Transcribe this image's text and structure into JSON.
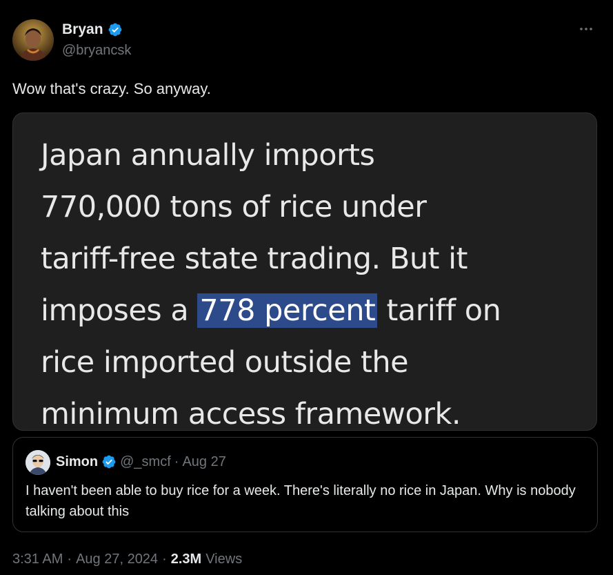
{
  "author": {
    "name": "Bryan",
    "handle": "@bryancsk",
    "verified_color": "#1d9bf0"
  },
  "menu_icon": "more-horizontal-icon",
  "tweet": {
    "text": "Wow that's crazy. So anyway."
  },
  "media": {
    "lines": [
      "Japan annually imports",
      "770,000 tons of rice under",
      "tariff-free state trading. But it"
    ],
    "line4_before": "imposes a ",
    "line4_highlight": "778 percent",
    "line4_after": " tariff on",
    "line5": "rice imported outside the",
    "line6": "minimum access framework.",
    "background": "#1f1f1f",
    "highlight_color": "#2d4a8a"
  },
  "quoted": {
    "name": "Simon",
    "handle": "@_smcf",
    "separator": "·",
    "date": "Aug 27",
    "text": "I haven't been able to buy rice for a week. There's literally no rice in Japan. Why is nobody talking about this"
  },
  "meta": {
    "time": "3:31 AM",
    "sep1": "·",
    "date": "Aug 27, 2024",
    "sep2": "·",
    "views_count": "2.3M",
    "views_label": "Views"
  }
}
